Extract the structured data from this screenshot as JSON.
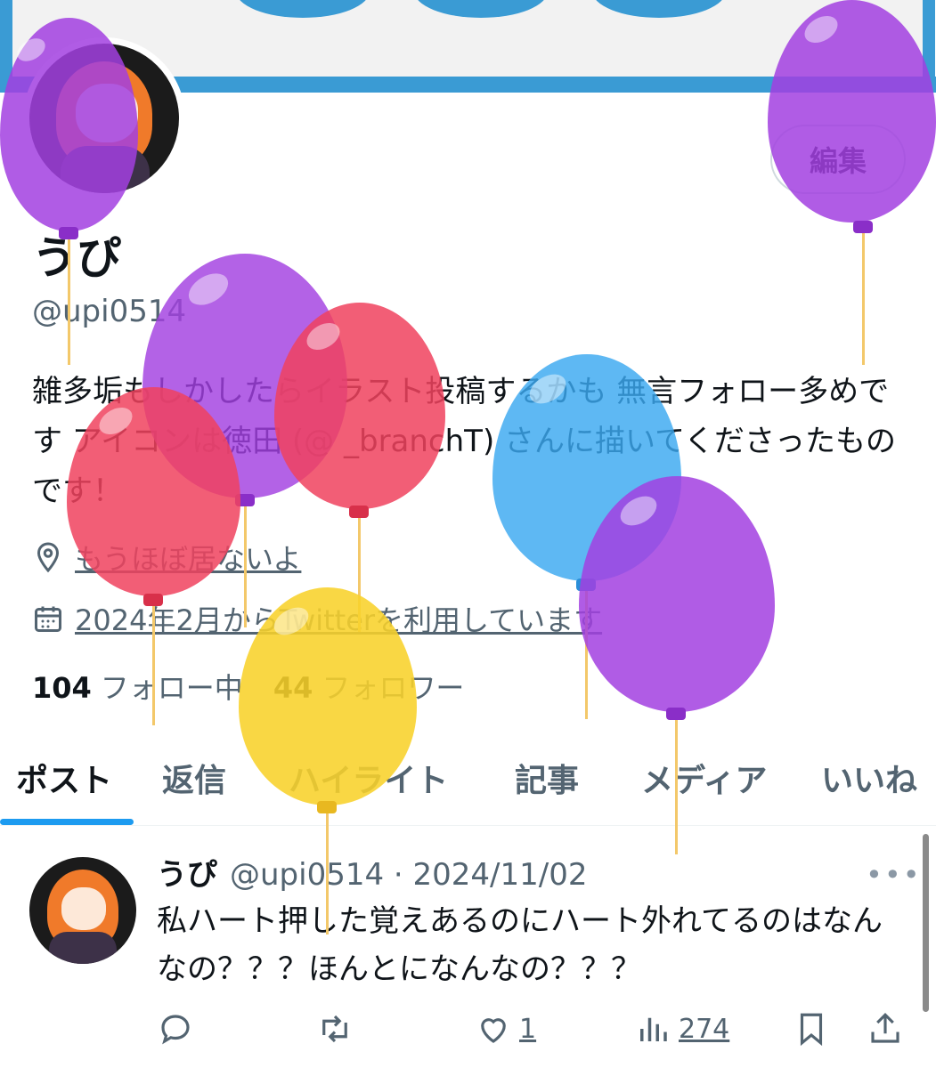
{
  "profile": {
    "edit_label": "編集",
    "display_name": "うぴ",
    "handle": "@upi0514",
    "bio": "雑多垢もしかしたらイラスト投稿するかも 無言フォロー多めです アイコンは徳田 (@ _branchT) さんに描いてくださったものです！",
    "location": "もうほぼ居ないよ",
    "joined": "2024年2月からTwitterを利用しています",
    "following_count": "104",
    "following_label": "フォロー中",
    "followers_count": "44",
    "followers_label": "フォロワー"
  },
  "tabs": [
    {
      "label": "ポスト"
    },
    {
      "label": "返信"
    },
    {
      "label": "ハイライト"
    },
    {
      "label": "記事"
    },
    {
      "label": "メディア"
    },
    {
      "label": "いいね"
    }
  ],
  "post": {
    "author": "うぴ",
    "meta": "@upi0514 · 2024/11/02",
    "text": "私ハート押した覚えあるのにハート外れてるのはなんなの？？？ほんとになんなの？？？",
    "more": "•••",
    "likes": "1",
    "views": "274"
  },
  "icons": {
    "location": "location-pin-icon",
    "calendar": "calendar-icon",
    "reply": "reply-icon",
    "repost": "repost-icon",
    "like": "heart-icon",
    "views": "views-icon",
    "bookmark": "bookmark-icon",
    "share": "share-icon"
  },
  "colors": {
    "accent": "#1d9bf0",
    "text_secondary": "#536471",
    "banner_blue": "#3a9bd4",
    "balloon_purple": "#a23fe0",
    "balloon_red": "#f0425e",
    "balloon_blue": "#3aa8f0",
    "balloon_yellow": "#f8d22a"
  }
}
